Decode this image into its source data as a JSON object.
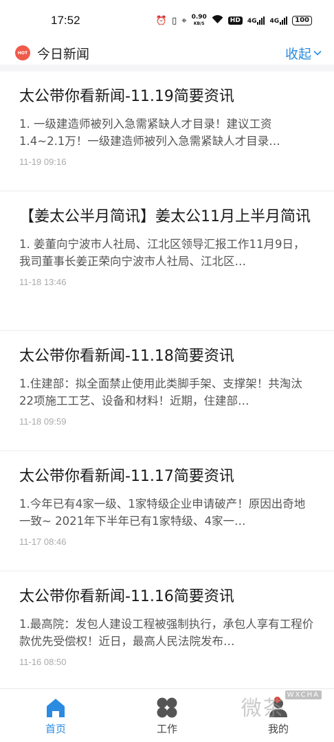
{
  "status_bar": {
    "time": "17:52",
    "net_speed_value": "0.90",
    "net_speed_unit": "KB/S",
    "hd_badge": "HD",
    "signal1_label": "4G",
    "signal2_label": "4G",
    "battery": "100"
  },
  "header": {
    "hot_badge": "HOT",
    "title": "今日新闻",
    "collapse_label": "收起"
  },
  "news": [
    {
      "title": "太公带你看新闻-11.19简要资讯",
      "summary": "1. 一级建造师被列入急需紧缺人才目录！建议工资1.4~2.1万！一级建造师被列入急需紧缺人才目录…",
      "time": "11-19 09:16"
    },
    {
      "title": "【姜太公半月简讯】姜太公11月上半月简讯",
      "summary": "1. 姜董向宁波市人社局、江北区领导汇报工作11月9日，我司董事长姜正荣向宁波市人社局、江北区…",
      "time": "11-18 13:46"
    },
    {
      "title": "太公带你看新闻-11.18简要资讯",
      "summary": "1.住建部：拟全面禁止使用此类脚手架、支撑架！共淘汰22项施工工艺、设备和材料！近期，住建部…",
      "time": "11-18 09:59"
    },
    {
      "title": "太公带你看新闻-11.17简要资讯",
      "summary": "1.今年已有4家一级、1家特级企业申请破产！原因出奇地一致~ 2021年下半年已有1家特级、4家一…",
      "time": "11-17 08:46"
    },
    {
      "title": "太公带你看新闻-11.16简要资讯",
      "summary": "1.最高院：发包人建设工程被强制执行，承包人享有工程价款优先受偿权！近日，最高人民法院发布…",
      "time": "11-16 08:50"
    }
  ],
  "tabbar": {
    "home": "首页",
    "work": "工作",
    "mine": "我的"
  },
  "watermark": {
    "text": "微茶",
    "tag": "WXCHA"
  },
  "colors": {
    "accent": "#2a8be0",
    "hot": "#f05a4a",
    "badge": "#e23b2e"
  }
}
